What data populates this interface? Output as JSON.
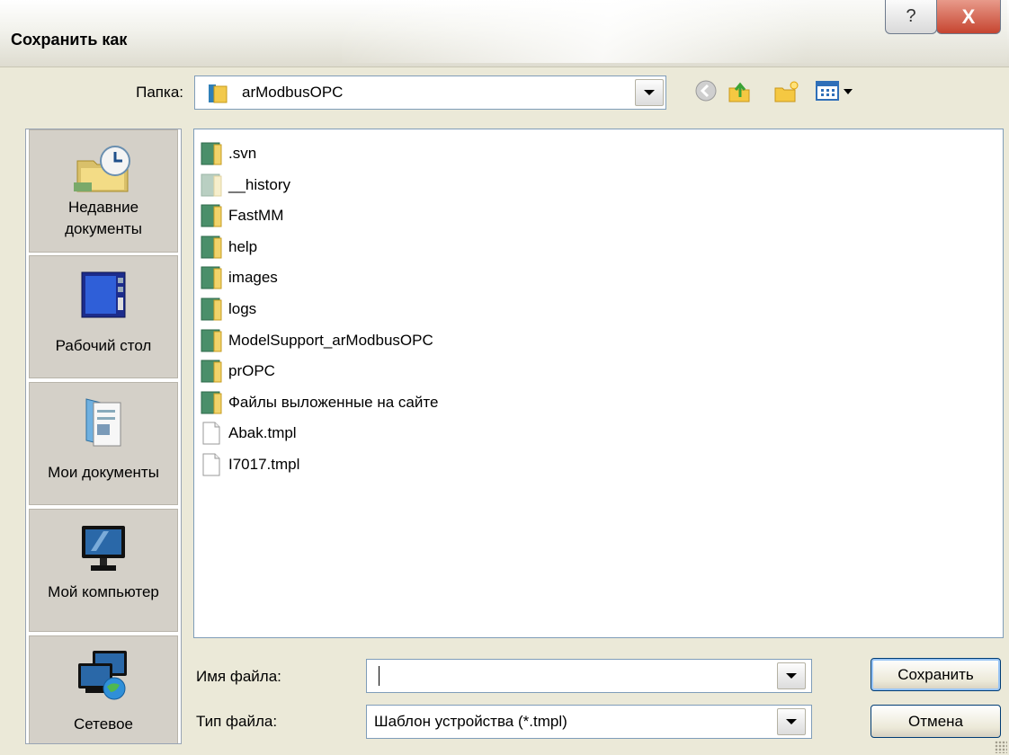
{
  "window": {
    "title": "Сохранить как",
    "help_glyph": "?",
    "close_glyph": "X"
  },
  "toolbar": {
    "folder_label": "Папка:",
    "folder_value": "arModbusOPC",
    "icons": [
      "back-icon",
      "up-folder-icon",
      "new-folder-icon",
      "views-menu-icon"
    ]
  },
  "places": [
    {
      "label": "Недавние документы",
      "icon": "recent-documents-icon"
    },
    {
      "label": "Рабочий стол",
      "icon": "desktop-icon"
    },
    {
      "label": "Мои документы",
      "icon": "my-documents-icon"
    },
    {
      "label": "Мой компьютер",
      "icon": "my-computer-icon"
    },
    {
      "label": "Сетевое",
      "icon": "network-icon"
    }
  ],
  "files": [
    {
      "name": ".svn",
      "type": "folder"
    },
    {
      "name": "__history",
      "type": "folder-hidden"
    },
    {
      "name": "FastMM",
      "type": "folder"
    },
    {
      "name": "help",
      "type": "folder"
    },
    {
      "name": "images",
      "type": "folder"
    },
    {
      "name": "logs",
      "type": "folder"
    },
    {
      "name": "ModelSupport_arModbusOPC",
      "type": "folder"
    },
    {
      "name": "prOPC",
      "type": "folder"
    },
    {
      "name": "Файлы выложенные на сайте",
      "type": "folder"
    },
    {
      "name": "Abak.tmpl",
      "type": "file"
    },
    {
      "name": "I7017.tmpl",
      "type": "file"
    }
  ],
  "form": {
    "filename_label": "Имя файла:",
    "filename_value": "",
    "filetype_label": "Тип файла:",
    "filetype_value": "Шаблон устройства (*.tmpl)",
    "save_label": "Сохранить",
    "cancel_label": "Отмена"
  },
  "colors": {
    "close_button": "#c64530",
    "dialog_bg": "#ebe9d8",
    "folder_icon": "#4a8f6a",
    "field_border": "#7f9db9"
  }
}
